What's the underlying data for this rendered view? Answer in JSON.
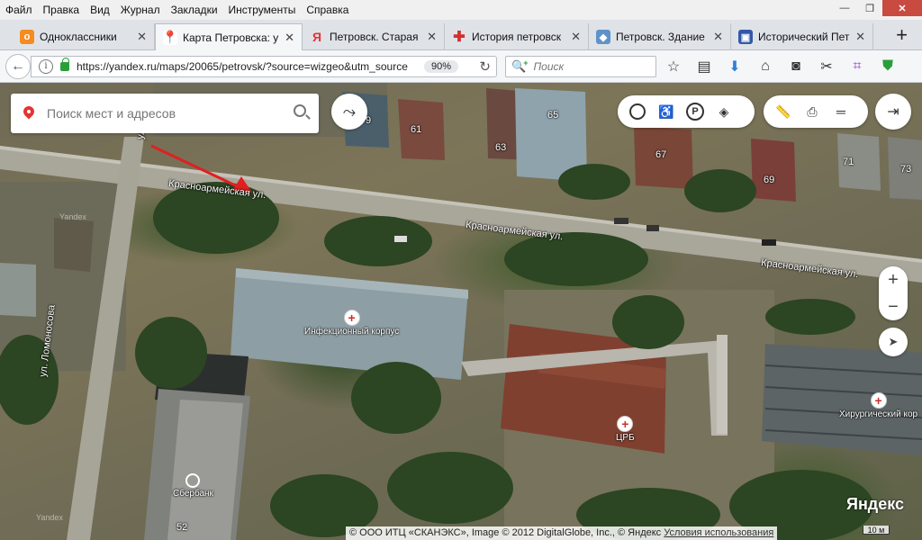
{
  "menu": [
    "Файл",
    "Правка",
    "Вид",
    "Журнал",
    "Закладки",
    "Инструменты",
    "Справка"
  ],
  "tabs": [
    {
      "label": "Одноклассники",
      "icon": "odnoklassniki-icon",
      "color": "#f68b1f",
      "glyph": "о"
    },
    {
      "label": "Карта Петровска: у",
      "icon": "yandex-maps-pin-icon",
      "color": "#e53333",
      "glyph": "●",
      "active": true
    },
    {
      "label": "Петровск. Старая",
      "icon": "yandex-icon",
      "color": "#e53333",
      "glyph": "Я"
    },
    {
      "label": "История петровск",
      "icon": "red-cross-icon",
      "color": "#d32f2f",
      "glyph": "✚"
    },
    {
      "label": "Петровск. Здание",
      "icon": "globe-icon",
      "color": "#5f93c7",
      "glyph": "◆"
    },
    {
      "label": "Исторический Пет",
      "icon": "site-icon",
      "color": "#3458a8",
      "glyph": "▣"
    }
  ],
  "nav": {
    "url": "https://yandex.ru/maps/20065/petrovsk/?source=wizgeo&utm_source",
    "zoom": "90%",
    "search_placeholder": "Поиск"
  },
  "map": {
    "search_placeholder": "Поиск мест и адресов",
    "house_numbers": [
      "61",
      "63",
      "65",
      "67",
      "69",
      "71",
      "73",
      "9",
      "52"
    ],
    "streets": {
      "krasnoarmeyskaya": "Красноармейская ул.",
      "lomonosova": "ул. Ломоносова",
      "top_left": "ул."
    },
    "pois": {
      "infection": "Инфекционный корпус",
      "crb": "ЦРБ",
      "surgery": "Хирургический кор",
      "sberbank": "Сбербанк"
    },
    "watermark": "Yandex",
    "wordmark": "Яндекс",
    "scale": "10 м",
    "copyright": "© ООО ИТЦ «СКАНЭКС», Image © 2012 DigitalGlobe, Inc., © Яндекс",
    "terms": "Условия использования"
  }
}
